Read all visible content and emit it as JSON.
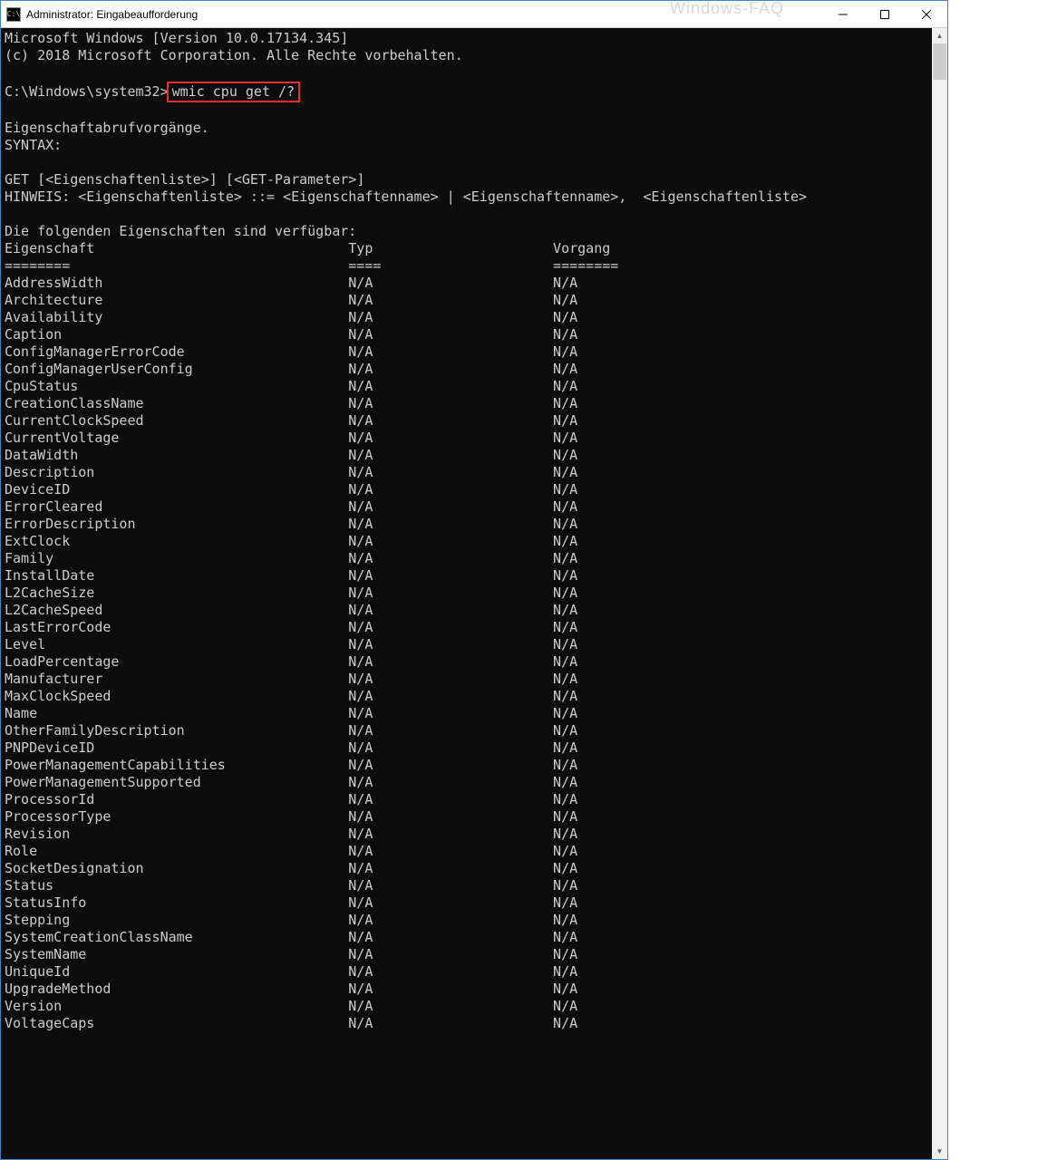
{
  "window": {
    "icon_glyph": "C:\\",
    "title": "Administrator: Eingabeaufforderung"
  },
  "watermark": "Windows-FAQ",
  "console": {
    "version_line": "Microsoft Windows [Version 10.0.17134.345]",
    "copyright_line": "(c) 2018 Microsoft Corporation. Alle Rechte vorbehalten.",
    "prompt": "C:\\Windows\\system32>",
    "command": "wmic cpu get /?",
    "section_title": "Eigenschaftabrufvorgänge.",
    "syntax_label": "SYNTAX:",
    "syntax_line": "GET [<Eigenschaftenliste>] [<GET-Parameter>]",
    "hint_line": "HINWEIS: <Eigenschaftenliste> ::= <Eigenschaftenname> | <Eigenschaftenname>,  <Eigenschaftenliste>",
    "avail_line": "Die folgenden Eigenschaften sind verfügbar:",
    "headers": {
      "name": "Eigenschaft",
      "type": "Typ",
      "op": "Vorgang"
    },
    "underlines": {
      "name": "========",
      "type": "====",
      "op": "========"
    },
    "properties": [
      {
        "name": "AddressWidth",
        "type": "N/A",
        "op": "N/A"
      },
      {
        "name": "Architecture",
        "type": "N/A",
        "op": "N/A"
      },
      {
        "name": "Availability",
        "type": "N/A",
        "op": "N/A"
      },
      {
        "name": "Caption",
        "type": "N/A",
        "op": "N/A"
      },
      {
        "name": "ConfigManagerErrorCode",
        "type": "N/A",
        "op": "N/A"
      },
      {
        "name": "ConfigManagerUserConfig",
        "type": "N/A",
        "op": "N/A"
      },
      {
        "name": "CpuStatus",
        "type": "N/A",
        "op": "N/A"
      },
      {
        "name": "CreationClassName",
        "type": "N/A",
        "op": "N/A"
      },
      {
        "name": "CurrentClockSpeed",
        "type": "N/A",
        "op": "N/A"
      },
      {
        "name": "CurrentVoltage",
        "type": "N/A",
        "op": "N/A"
      },
      {
        "name": "DataWidth",
        "type": "N/A",
        "op": "N/A"
      },
      {
        "name": "Description",
        "type": "N/A",
        "op": "N/A"
      },
      {
        "name": "DeviceID",
        "type": "N/A",
        "op": "N/A"
      },
      {
        "name": "ErrorCleared",
        "type": "N/A",
        "op": "N/A"
      },
      {
        "name": "ErrorDescription",
        "type": "N/A",
        "op": "N/A"
      },
      {
        "name": "ExtClock",
        "type": "N/A",
        "op": "N/A"
      },
      {
        "name": "Family",
        "type": "N/A",
        "op": "N/A"
      },
      {
        "name": "InstallDate",
        "type": "N/A",
        "op": "N/A"
      },
      {
        "name": "L2CacheSize",
        "type": "N/A",
        "op": "N/A"
      },
      {
        "name": "L2CacheSpeed",
        "type": "N/A",
        "op": "N/A"
      },
      {
        "name": "LastErrorCode",
        "type": "N/A",
        "op": "N/A"
      },
      {
        "name": "Level",
        "type": "N/A",
        "op": "N/A"
      },
      {
        "name": "LoadPercentage",
        "type": "N/A",
        "op": "N/A"
      },
      {
        "name": "Manufacturer",
        "type": "N/A",
        "op": "N/A"
      },
      {
        "name": "MaxClockSpeed",
        "type": "N/A",
        "op": "N/A"
      },
      {
        "name": "Name",
        "type": "N/A",
        "op": "N/A"
      },
      {
        "name": "OtherFamilyDescription",
        "type": "N/A",
        "op": "N/A"
      },
      {
        "name": "PNPDeviceID",
        "type": "N/A",
        "op": "N/A"
      },
      {
        "name": "PowerManagementCapabilities",
        "type": "N/A",
        "op": "N/A"
      },
      {
        "name": "PowerManagementSupported",
        "type": "N/A",
        "op": "N/A"
      },
      {
        "name": "ProcessorId",
        "type": "N/A",
        "op": "N/A"
      },
      {
        "name": "ProcessorType",
        "type": "N/A",
        "op": "N/A"
      },
      {
        "name": "Revision",
        "type": "N/A",
        "op": "N/A"
      },
      {
        "name": "Role",
        "type": "N/A",
        "op": "N/A"
      },
      {
        "name": "SocketDesignation",
        "type": "N/A",
        "op": "N/A"
      },
      {
        "name": "Status",
        "type": "N/A",
        "op": "N/A"
      },
      {
        "name": "StatusInfo",
        "type": "N/A",
        "op": "N/A"
      },
      {
        "name": "Stepping",
        "type": "N/A",
        "op": "N/A"
      },
      {
        "name": "SystemCreationClassName",
        "type": "N/A",
        "op": "N/A"
      },
      {
        "name": "SystemName",
        "type": "N/A",
        "op": "N/A"
      },
      {
        "name": "UniqueId",
        "type": "N/A",
        "op": "N/A"
      },
      {
        "name": "UpgradeMethod",
        "type": "N/A",
        "op": "N/A"
      },
      {
        "name": "Version",
        "type": "N/A",
        "op": "N/A"
      },
      {
        "name": "VoltageCaps",
        "type": "N/A",
        "op": "N/A"
      }
    ]
  }
}
